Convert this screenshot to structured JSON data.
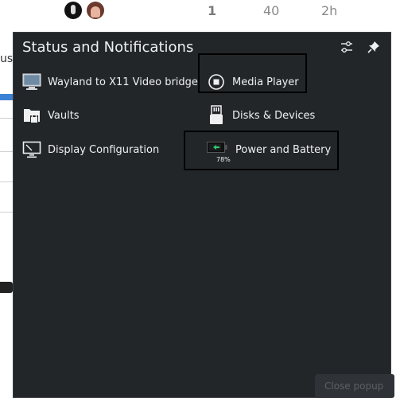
{
  "topbar": {
    "stats": [
      "1",
      "40",
      "2h"
    ]
  },
  "background": {
    "left_text": "us"
  },
  "popup": {
    "title": "Status and Notifications",
    "items_left": [
      {
        "label": "Wayland to X11 Video bridge",
        "icon": "monitor-icon"
      },
      {
        "label": "Vaults",
        "icon": "vault-folder-lock-icon"
      },
      {
        "label": "Display Configuration",
        "icon": "display-config-icon"
      }
    ],
    "items_right": [
      {
        "label": "Media Player",
        "icon": "stop-circle-icon"
      },
      {
        "label": "Disks & Devices",
        "icon": "usb-drive-icon"
      },
      {
        "label": "Power and Battery",
        "icon": "battery-icon",
        "battery_percent": "78%"
      }
    ],
    "footer_button": "Close popup"
  },
  "colors": {
    "popup_bg": "#232629",
    "text": "#eff0f1",
    "battery_green": "#2ecc71",
    "highlight": "#000000"
  }
}
